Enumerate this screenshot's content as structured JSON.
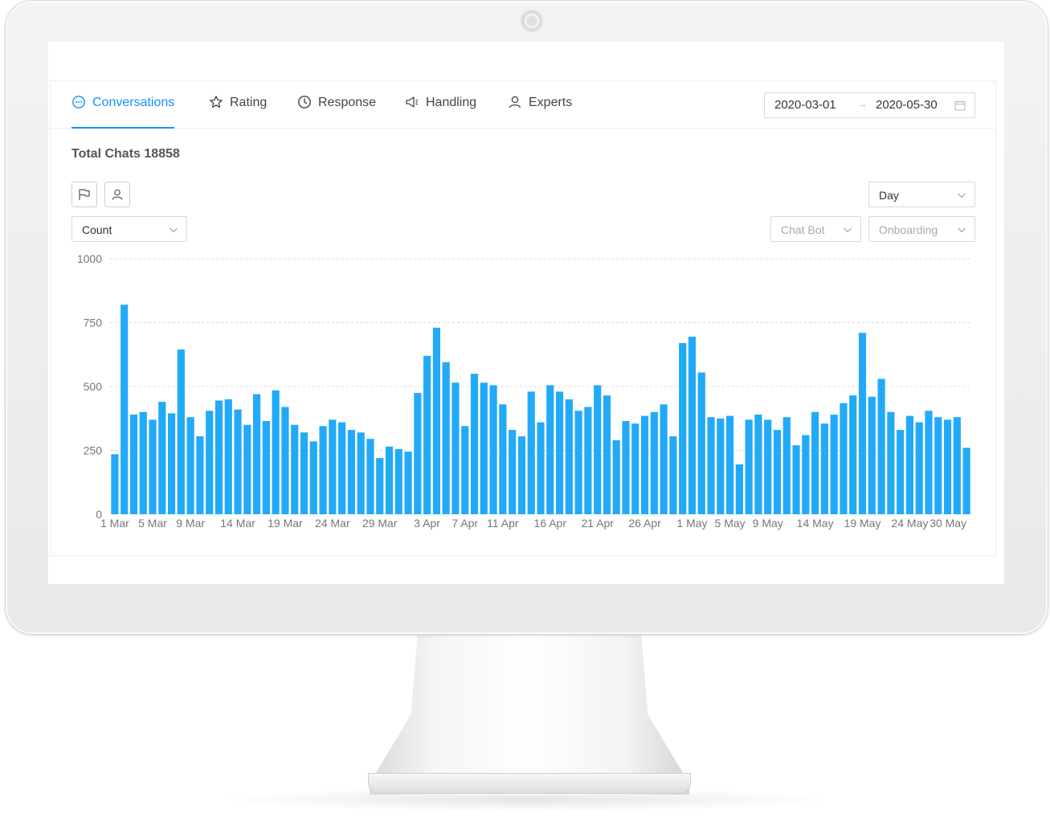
{
  "tabs": [
    {
      "label": "Conversations",
      "icon": "chat-bubble-icon",
      "active": true
    },
    {
      "label": "Rating",
      "icon": "star-icon",
      "active": false
    },
    {
      "label": "Response",
      "icon": "clock-icon",
      "active": false
    },
    {
      "label": "Handling",
      "icon": "megaphone-icon",
      "active": false
    },
    {
      "label": "Experts",
      "icon": "user-icon",
      "active": false
    }
  ],
  "date_range": {
    "start": "2020-03-01",
    "separator": "→",
    "end": "2020-05-30",
    "icon": "calendar-icon"
  },
  "summary": {
    "label": "Total Chats",
    "value": "18858"
  },
  "toolbar": {
    "flag_icon": "flag-icon",
    "user_icon": "users-icon",
    "granularity": "Day",
    "metric": "Count",
    "bot_filter": "Chat Bot",
    "flow_filter": "Onboarding"
  },
  "colors": {
    "accent": "#1890ff",
    "bar": "#22aaf8"
  },
  "chart_data": {
    "type": "bar",
    "ylim": [
      0,
      1000
    ],
    "yticks": [
      0,
      250,
      500,
      750,
      1000
    ],
    "grid": true,
    "x_tick_labels": [
      {
        "index": 0,
        "label": "1 Mar"
      },
      {
        "index": 4,
        "label": "5 Mar"
      },
      {
        "index": 8,
        "label": "9 Mar"
      },
      {
        "index": 13,
        "label": "14 Mar"
      },
      {
        "index": 18,
        "label": "19 Mar"
      },
      {
        "index": 23,
        "label": "24 Mar"
      },
      {
        "index": 28,
        "label": "29 Mar"
      },
      {
        "index": 33,
        "label": "3 Apr"
      },
      {
        "index": 37,
        "label": "7 Apr"
      },
      {
        "index": 41,
        "label": "11 Apr"
      },
      {
        "index": 46,
        "label": "16 Apr"
      },
      {
        "index": 51,
        "label": "21 Apr"
      },
      {
        "index": 56,
        "label": "26 Apr"
      },
      {
        "index": 61,
        "label": "1 May"
      },
      {
        "index": 65,
        "label": "5 May"
      },
      {
        "index": 69,
        "label": "9 May"
      },
      {
        "index": 74,
        "label": "14 May"
      },
      {
        "index": 79,
        "label": "19 May"
      },
      {
        "index": 84,
        "label": "24 May"
      },
      {
        "index": 90,
        "label": "30 May"
      }
    ],
    "values": [
      235,
      820,
      390,
      400,
      370,
      440,
      395,
      645,
      380,
      305,
      405,
      445,
      450,
      410,
      350,
      470,
      365,
      485,
      420,
      350,
      320,
      285,
      345,
      370,
      360,
      330,
      320,
      295,
      220,
      265,
      255,
      245,
      475,
      620,
      730,
      595,
      515,
      345,
      550,
      515,
      505,
      430,
      330,
      305,
      480,
      360,
      505,
      480,
      450,
      405,
      420,
      505,
      465,
      290,
      365,
      355,
      385,
      400,
      430,
      305,
      670,
      695,
      555,
      380,
      375,
      385,
      195,
      370,
      390,
      370,
      330,
      380,
      270,
      310,
      400,
      355,
      390,
      435,
      465,
      710,
      460,
      530,
      400,
      330,
      385,
      360,
      405,
      380,
      370,
      380,
      260
    ]
  }
}
